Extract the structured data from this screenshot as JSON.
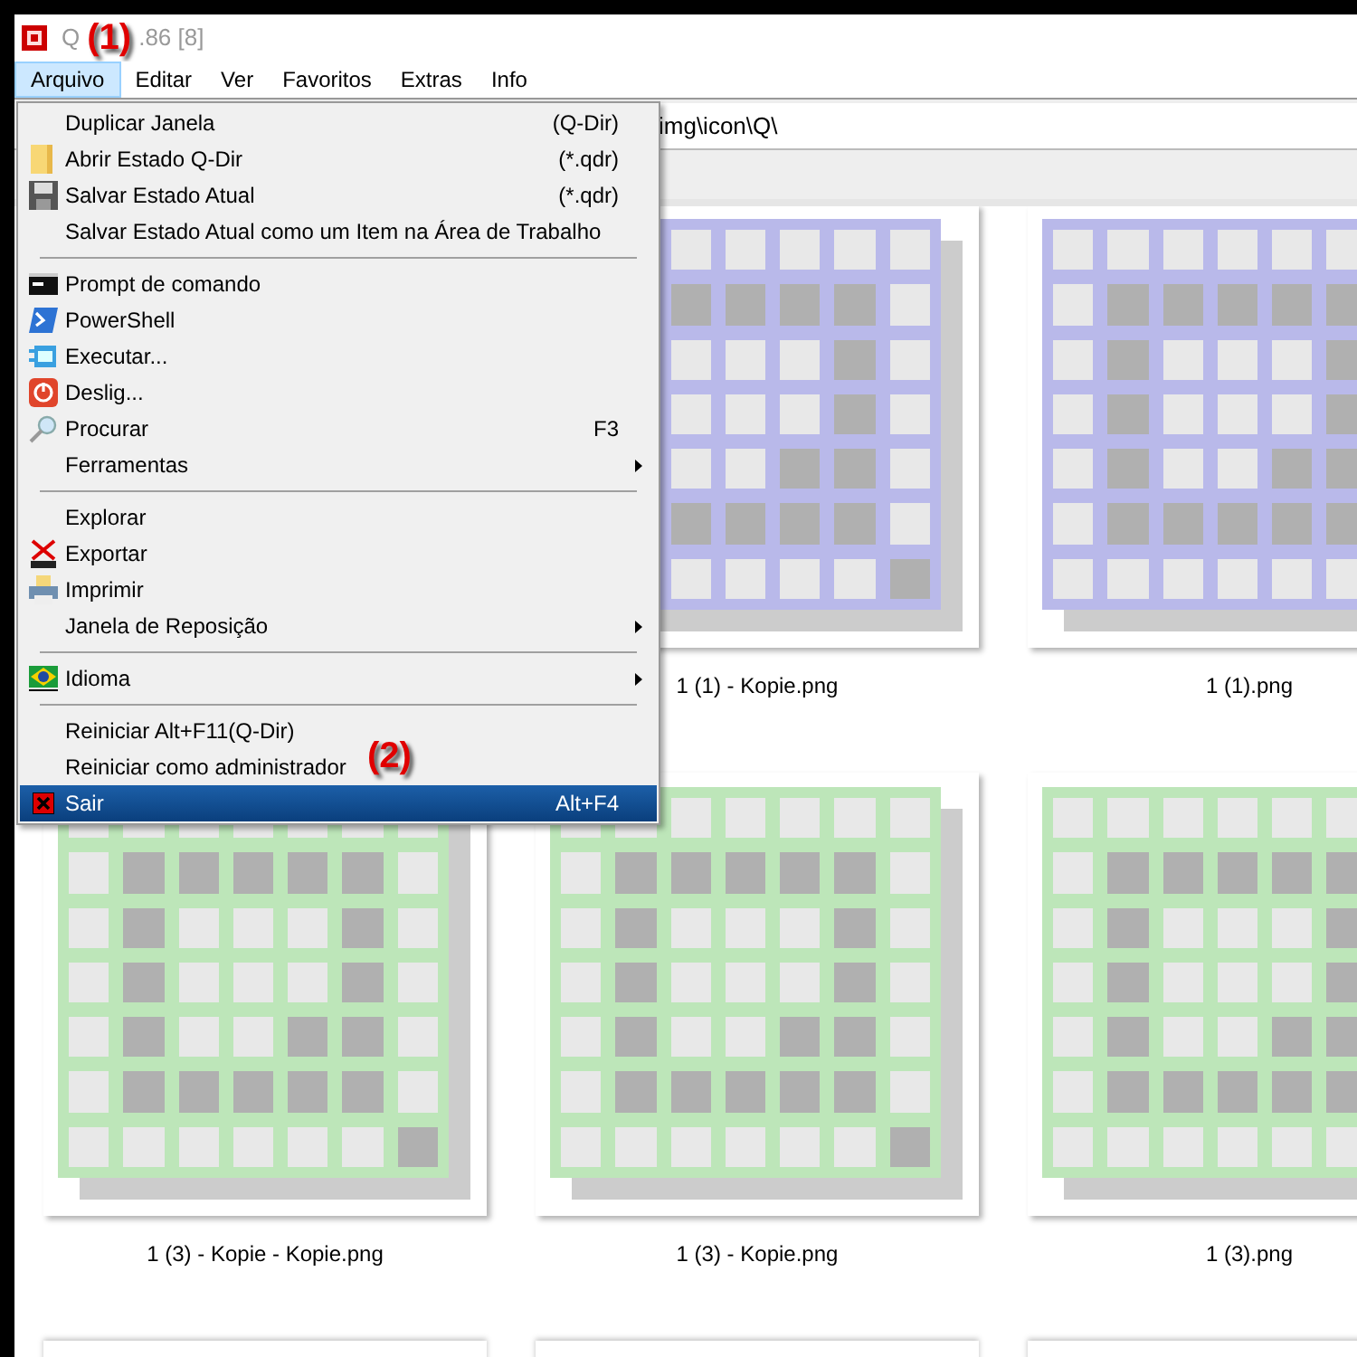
{
  "window": {
    "title_start": "Q",
    "title_end": ".86 [8]"
  },
  "annotations": [
    "(1)",
    "(2)"
  ],
  "menu_bar": [
    {
      "label": "Arquivo",
      "selected": true
    },
    {
      "label": "Editar",
      "selected": false
    },
    {
      "label": "Ver",
      "selected": false
    },
    {
      "label": "Favoritos",
      "selected": false
    },
    {
      "label": "Extras",
      "selected": false
    },
    {
      "label": "Info",
      "selected": false
    }
  ],
  "address": {
    "value": "img\\icon\\Q\\"
  },
  "menu": [
    {
      "kind": "item",
      "label": "Duplicar Janela",
      "shortcut": "(Q-Dir)",
      "submenu": false,
      "selected": false
    },
    {
      "kind": "item",
      "label": "Abrir Estado Q-Dir",
      "shortcut": "(*.qdr)",
      "submenu": false,
      "selected": false
    },
    {
      "kind": "item",
      "label": "Salvar Estado Atual",
      "shortcut": "(*.qdr)",
      "submenu": false,
      "selected": false
    },
    {
      "kind": "item",
      "label": "Salvar Estado Atual como um Item na Área de Trabalho",
      "submenu": false,
      "selected": false
    },
    {
      "kind": "separator"
    },
    {
      "kind": "item",
      "label": "Prompt de comando",
      "submenu": false,
      "selected": false
    },
    {
      "kind": "item",
      "label": "PowerShell",
      "submenu": false,
      "selected": false
    },
    {
      "kind": "item",
      "label": "Executar...",
      "submenu": false,
      "selected": false
    },
    {
      "kind": "item",
      "label": "Deslig...",
      "submenu": false,
      "selected": false
    },
    {
      "kind": "item",
      "label": "Procurar",
      "shortcut": "F3",
      "submenu": false,
      "selected": false
    },
    {
      "kind": "item",
      "label": "Ferramentas",
      "submenu": true,
      "selected": false
    },
    {
      "kind": "separator"
    },
    {
      "kind": "item",
      "label": "Explorar",
      "submenu": false,
      "selected": false
    },
    {
      "kind": "item",
      "label": "Exportar",
      "submenu": false,
      "selected": false
    },
    {
      "kind": "item",
      "label": "Imprimir",
      "submenu": false,
      "selected": false
    },
    {
      "kind": "item",
      "label": "Janela de Reposição",
      "submenu": true,
      "selected": false
    },
    {
      "kind": "separator"
    },
    {
      "kind": "item",
      "label": "Idioma",
      "submenu": true,
      "selected": false
    },
    {
      "kind": "separator"
    },
    {
      "kind": "item",
      "label": "Reiniciar Alt+F11(Q-Dir)",
      "submenu": false,
      "selected": false
    },
    {
      "kind": "item",
      "label": "Reiniciar como administrador",
      "submenu": false,
      "selected": false
    },
    {
      "kind": "item",
      "label": "Sair",
      "shortcut": "Alt+F4",
      "submenu": false,
      "selected": true
    }
  ],
  "thumbnails": [
    {
      "name": "1 (1) - Kopie.png",
      "color": "#b9b9ea"
    },
    {
      "name": "1 (1).png",
      "color": "#b9b9ea"
    },
    {
      "name": "1 (3) - Kopie - Kopie.png",
      "color": "#bde6b9"
    },
    {
      "name": "1 (3) - Kopie.png",
      "color": "#bde6b9"
    },
    {
      "name": "1 (3).png",
      "color": "#bde6b9"
    }
  ]
}
